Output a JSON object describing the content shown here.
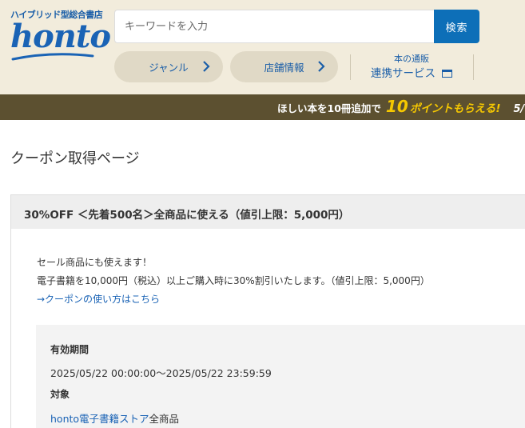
{
  "header": {
    "tagline": "ハイブリッド型総合書店",
    "logo": "honto",
    "search_placeholder": "キーワードを入力",
    "search_button": "検索",
    "nav": {
      "genre": "ジャンル",
      "store_info": "店舗情報",
      "renkei_small": "本の通販",
      "renkei_big": "連携サービス"
    }
  },
  "banner": {
    "text_before": "ほしい本を10冊追加で",
    "number": "10",
    "text_points": "ポイントもらえる!",
    "date_partial": "5/"
  },
  "page": {
    "title": "クーポン取得ページ"
  },
  "coupon": {
    "title": "30%OFF ＜先着500名＞全商品に使える（値引上限：5,000円）",
    "desc_line1": "セール商品にも使えます！",
    "desc_line2": "電子書籍を10,000円（税込）以上ご購入時に30%割引いたします。（値引上限：5,000円）",
    "howto_link": "→クーポンの使い方はこちら",
    "validity_label": "有効期間",
    "validity_value": "2025/05/22 00:00:00～2025/05/22 23:59:59",
    "target_label": "対象",
    "target_link": "honto電子書籍ストア",
    "target_suffix": "全商品"
  },
  "colors": {
    "brand_blue": "#1a63b5",
    "search_button": "#0d6fb8",
    "header_bg": "#f2ecdc",
    "banner_bg": "#5c5030",
    "banner_accent": "#f6c800"
  }
}
